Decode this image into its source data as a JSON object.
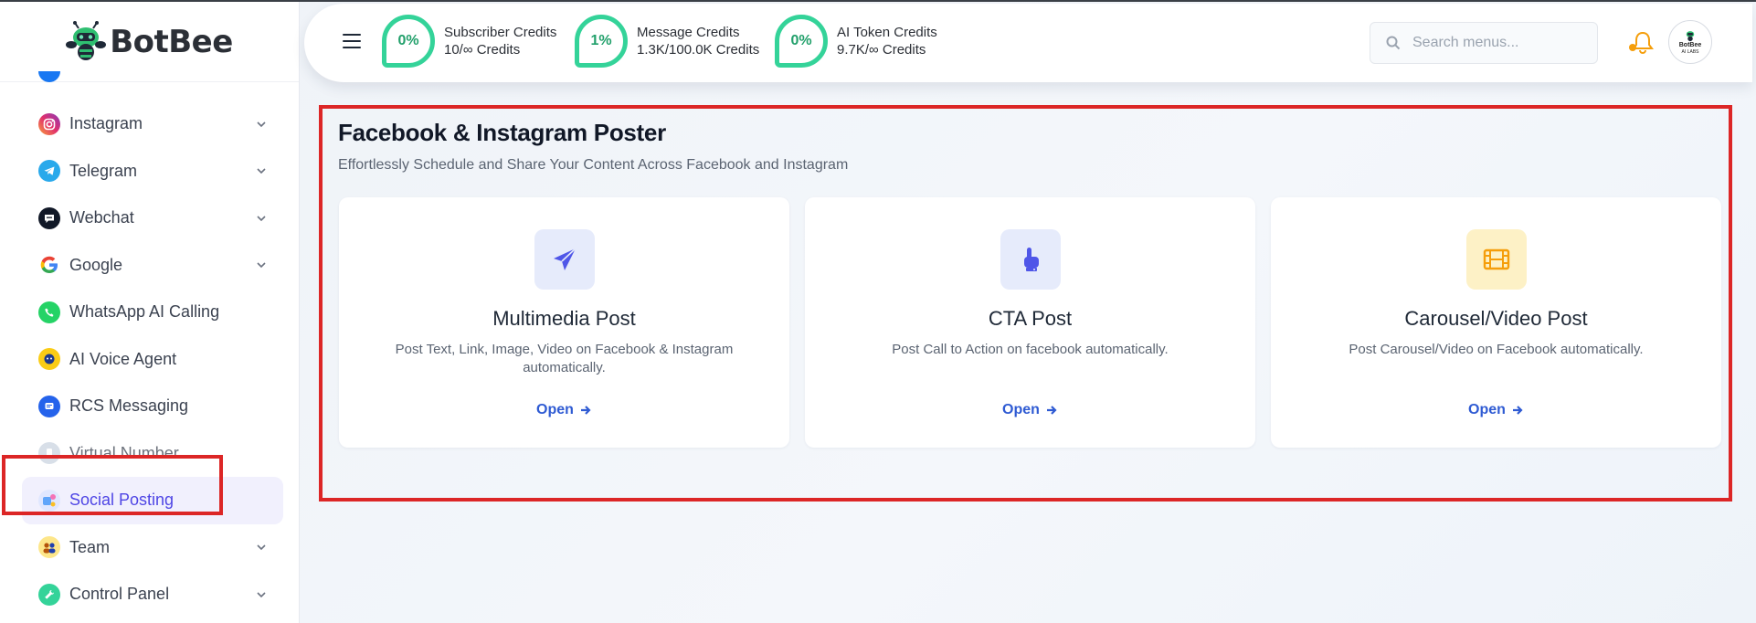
{
  "brand": {
    "name": "BotBee"
  },
  "sidebar": {
    "items": [
      {
        "label": "Instagram",
        "icon": "instagram-icon",
        "has_children": true
      },
      {
        "label": "Telegram",
        "icon": "telegram-icon",
        "has_children": true
      },
      {
        "label": "Webchat",
        "icon": "webchat-icon",
        "has_children": true
      },
      {
        "label": "Google",
        "icon": "google-icon",
        "has_children": true
      },
      {
        "label": "WhatsApp AI Calling",
        "icon": "whatsapp-call-icon",
        "has_children": false
      },
      {
        "label": "AI Voice Agent",
        "icon": "voice-agent-icon",
        "has_children": false
      },
      {
        "label": "RCS Messaging",
        "icon": "rcs-icon",
        "has_children": false
      },
      {
        "label": "Virtual Number",
        "icon": "phone-icon",
        "has_children": false
      },
      {
        "label": "Social Posting",
        "icon": "social-posting-icon",
        "has_children": false,
        "active": true
      },
      {
        "label": "Team",
        "icon": "team-icon",
        "has_children": true
      },
      {
        "label": "Control Panel",
        "icon": "wrench-icon",
        "has_children": true
      }
    ]
  },
  "header": {
    "credits": [
      {
        "percent": "0%",
        "label": "Subscriber Credits",
        "value": "10/∞ Credits"
      },
      {
        "percent": "1%",
        "label": "Message Credits",
        "value": "1.3K/100.0K Credits"
      },
      {
        "percent": "0%",
        "label": "AI Token Credits",
        "value": "9.7K/∞ Credits"
      }
    ],
    "search": {
      "placeholder": "Search menus..."
    },
    "avatar_text": "BotBee",
    "avatar_sub": "AI LABS"
  },
  "page": {
    "title": "Facebook & Instagram Poster",
    "subtitle": "Effortlessly Schedule and Share Your Content Across Facebook and Instagram"
  },
  "cards": [
    {
      "title": "Multimedia Post",
      "description": "Post Text, Link, Image, Video on Facebook & Instagram automatically.",
      "action": "Open",
      "icon": "paper-plane-icon"
    },
    {
      "title": "CTA Post",
      "description": "Post Call to Action on facebook automatically.",
      "action": "Open",
      "icon": "hand-pointer-icon"
    },
    {
      "title": "Carousel/Video Post",
      "description": "Post Carousel/Video on Facebook automatically.",
      "action": "Open",
      "icon": "film-icon"
    }
  ],
  "colors": {
    "accent": "#4f46e5",
    "credit_ring": "#34d399",
    "highlight": "#dc2626",
    "link": "#2f5bd3"
  }
}
